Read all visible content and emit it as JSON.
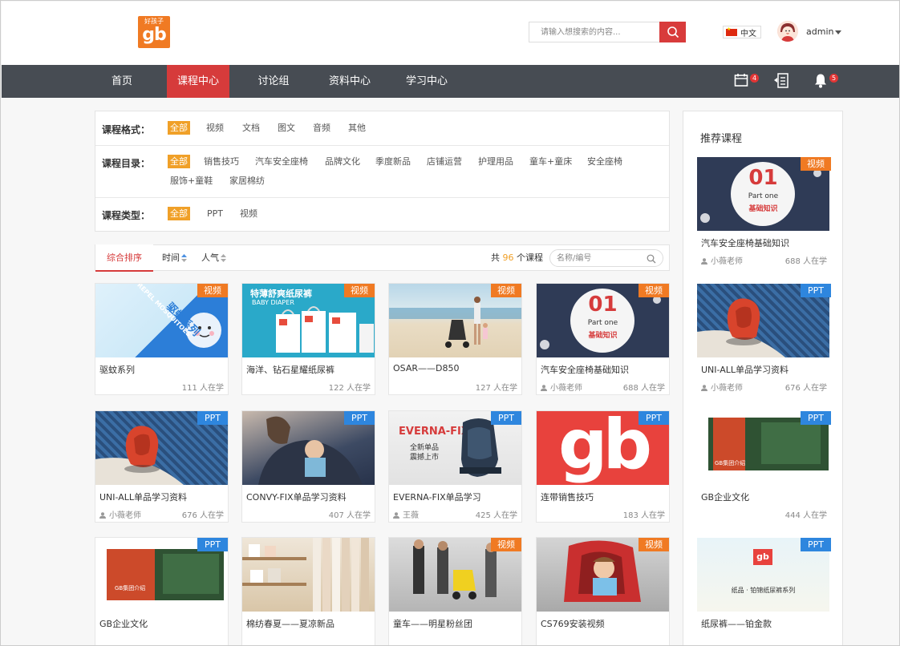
{
  "header": {
    "logo_small": "好孩子",
    "logo_big": "gb",
    "search_placeholder": "请输入想搜索的内容...",
    "language": "中文",
    "username": "admin"
  },
  "nav": {
    "items": [
      "首页",
      "课程中心",
      "讨论组",
      "资料中心",
      "学习中心"
    ],
    "active": "课程中心",
    "calendar_badge": "4",
    "bell_badge": "5"
  },
  "filters": {
    "format": {
      "label": "课程格式：",
      "options": [
        "全部",
        "视频",
        "文档",
        "图文",
        "音频",
        "其他"
      ]
    },
    "catalog": {
      "label": "课程目录：",
      "options": [
        "全部",
        "销售技巧",
        "汽车安全座椅",
        "品牌文化",
        "季度新品",
        "店铺运营",
        "护理用品",
        "童车+童床",
        "安全座椅",
        "服饰+童鞋",
        "家居棉纺"
      ]
    },
    "type": {
      "label": "课程类型：",
      "options": [
        "全部",
        "PPT",
        "视频"
      ]
    }
  },
  "sortbar": {
    "default": "综合排序",
    "time": "时间",
    "popularity": "人气",
    "count_prefix": "共",
    "count": "96",
    "count_suffix": "个课程",
    "search_placeholder": "名称/编号"
  },
  "courses": [
    {
      "tag": "视频",
      "title": "驱蚊系列",
      "author": "",
      "learners": "111 人在学"
    },
    {
      "tag": "视频",
      "title": "海洋、钻石星耀纸尿裤",
      "author": "",
      "learners": "122 人在学"
    },
    {
      "tag": "视频",
      "title": "OSAR——D850",
      "author": "",
      "learners": "127 人在学"
    },
    {
      "tag": "视频",
      "title": "汽车安全座椅基础知识",
      "author": "小薇老师",
      "learners": "688 人在学"
    },
    {
      "tag": "PPT",
      "title": "UNI-ALL单品学习资料",
      "author": "小薇老师",
      "learners": "676 人在学"
    },
    {
      "tag": "PPT",
      "title": "CONVY-FIX单品学习资料",
      "author": "",
      "learners": "407 人在学"
    },
    {
      "tag": "PPT",
      "title": "EVERNA-FIX单品学习",
      "author": "王薇",
      "learners": "425 人在学"
    },
    {
      "tag": "PPT",
      "title": "连带销售技巧",
      "author": "",
      "learners": "183 人在学"
    },
    {
      "tag": "PPT",
      "title": "GB企业文化",
      "author": "",
      "learners": ""
    },
    {
      "tag": "PPT",
      "title": "棉纺春夏——夏凉新品",
      "author": "",
      "learners": ""
    },
    {
      "tag": "视频",
      "title": "童车——明星粉丝团",
      "author": "",
      "learners": ""
    },
    {
      "tag": "视频",
      "title": "CS769安装视频",
      "author": "",
      "learners": ""
    }
  ],
  "sidebar": {
    "title": "推荐课程",
    "courses": [
      {
        "tag": "视频",
        "title": "汽车安全座椅基础知识",
        "author": "小薇老师",
        "learners": "688 人在学"
      },
      {
        "tag": "PPT",
        "title": "UNI-ALL单品学习资料",
        "author": "小薇老师",
        "learners": "676 人在学"
      },
      {
        "tag": "PPT",
        "title": "GB企业文化",
        "author": "",
        "learners": "444 人在学"
      },
      {
        "tag": "PPT",
        "title": "纸尿裤——铂金款",
        "author": "",
        "learners": ""
      }
    ]
  },
  "thumb_text": {
    "mosquito_en": "REPEL MOSQUITOES",
    "mosquito_cn": "驱蚊系列",
    "diaper_cn": "特薄舒爽纸尿裤",
    "diaper_en": "BABY DIAPER",
    "part_num": "01",
    "part_en": "Part one",
    "part_cn": "基础知识",
    "everna": "EVERNA-FIX",
    "everna_sub1": "全新单品",
    "everna_sub2": "震撼上市",
    "gb_word": "gb",
    "culture": "GB集团介绍",
    "platinum": "纸品 · 铂锦纸尿裤系列"
  }
}
